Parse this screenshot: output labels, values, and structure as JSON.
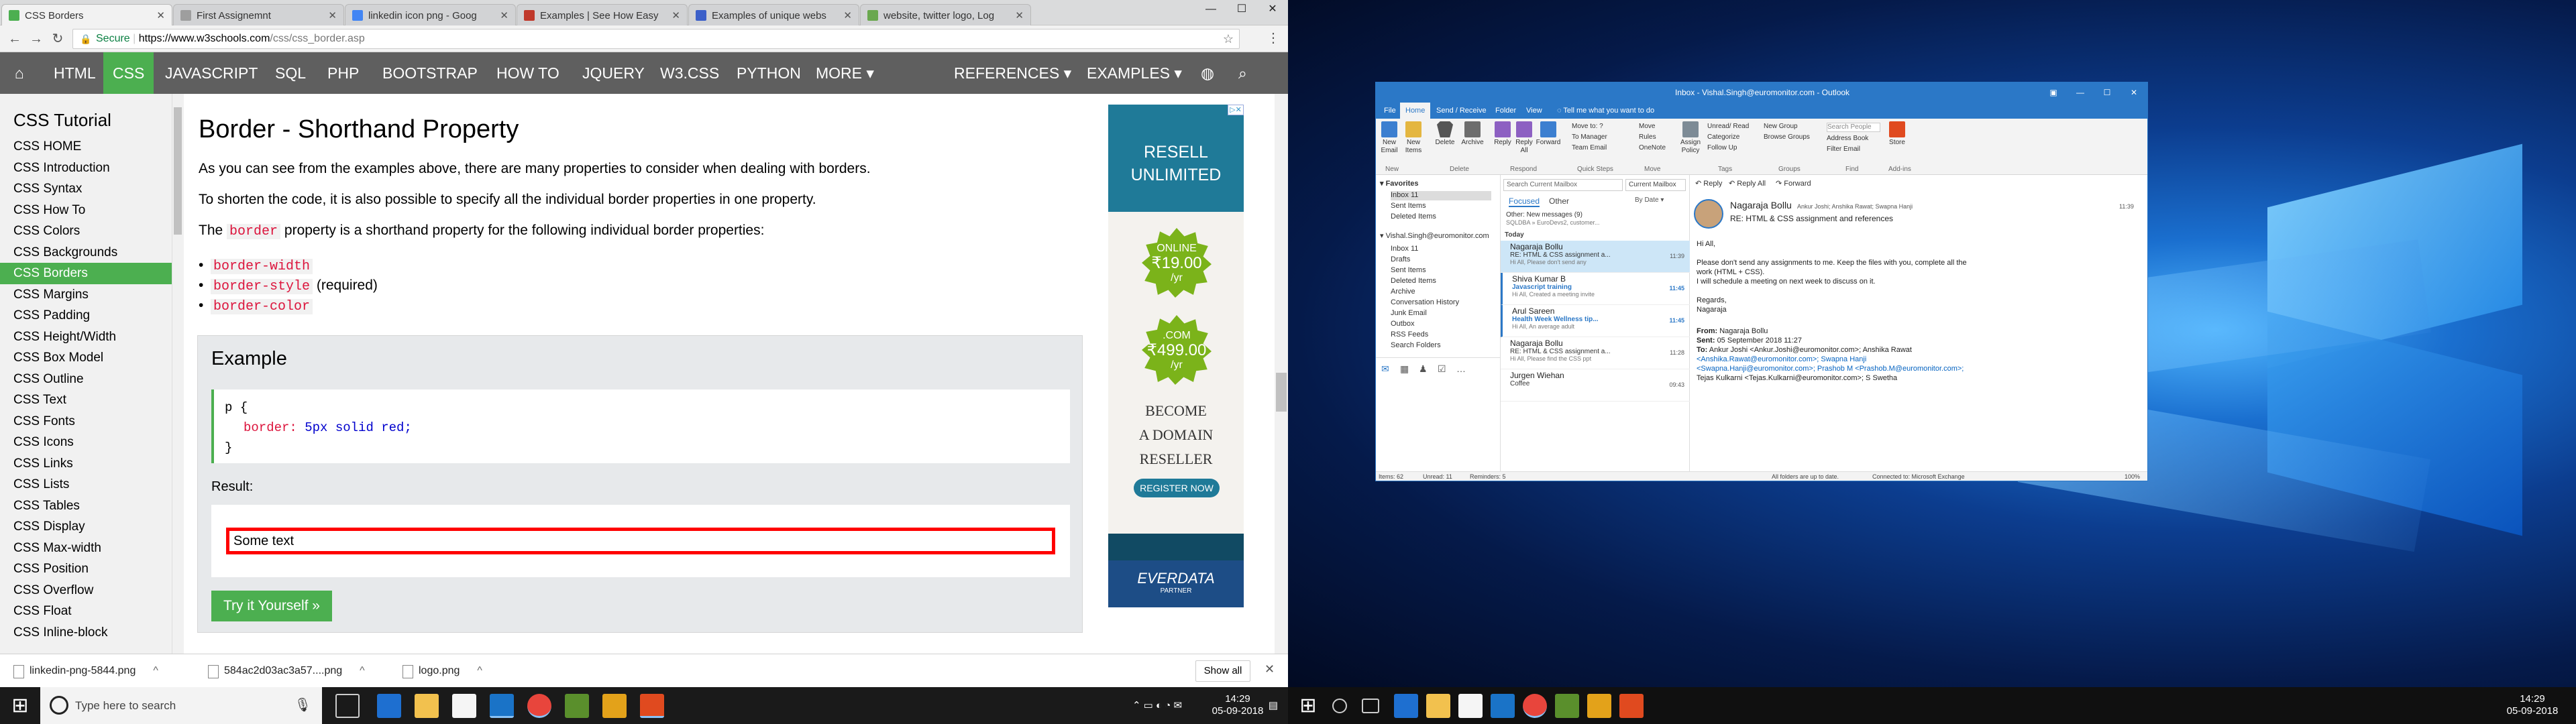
{
  "browser": {
    "tabs": [
      {
        "label": "CSS Borders",
        "color": "#4caf50"
      },
      {
        "label": "First Assignemnt",
        "color": "#9e9e9e"
      },
      {
        "label": "linkedin icon png - Goog",
        "color": "#9e9e9e"
      },
      {
        "label": "Examples | See How Easy",
        "color": "#c0392b"
      },
      {
        "label": "Examples of unique webs",
        "color": "#3b5fc9"
      },
      {
        "label": "website, twitter logo, Log",
        "color": "#6aa84f"
      }
    ],
    "address": {
      "secure": "Secure",
      "domain": "https://www.w3schools.com",
      "path": "/css/css_border.asp"
    }
  },
  "w3nav": {
    "items": [
      "HTML",
      "CSS",
      "JAVASCRIPT",
      "SQL",
      "PHP",
      "BOOTSTRAP",
      "HOW TO",
      "JQUERY",
      "W3.CSS",
      "PYTHON",
      "MORE ▾",
      "REFERENCES ▾",
      "EXAMPLES ▾"
    ],
    "active": "CSS"
  },
  "sidebar": {
    "title": "CSS Tutorial",
    "items": [
      "CSS HOME",
      "CSS Introduction",
      "CSS Syntax",
      "CSS How To",
      "CSS Colors",
      "CSS Backgrounds",
      "CSS Borders",
      "CSS Margins",
      "CSS Padding",
      "CSS Height/Width",
      "CSS Box Model",
      "CSS Outline",
      "CSS Text",
      "CSS Fonts",
      "CSS Icons",
      "CSS Links",
      "CSS Lists",
      "CSS Tables",
      "CSS Display",
      "CSS Max-width",
      "CSS Position",
      "CSS Overflow",
      "CSS Float",
      "CSS Inline-block"
    ],
    "active": "CSS Borders"
  },
  "main": {
    "heading": "Border - Shorthand Property",
    "p1": "As you can see from the examples above, there are many properties to consider when dealing with borders.",
    "p2": "To shorten the code, it is also possible to specify all the individual border properties in one property.",
    "p3a": "The",
    "p3code": "border",
    "p3b": "property is a shorthand property for the following individual border properties:",
    "bullets": [
      {
        "code": "border-width",
        "text": ""
      },
      {
        "code": "border-style",
        "text": "(required)"
      },
      {
        "code": "border-color",
        "text": ""
      }
    ],
    "example": {
      "title": "Example",
      "code_selector": "p {",
      "code_prop": "border:",
      "code_value": "5px solid red;",
      "code_close": "}",
      "result_label": "Result:",
      "result_text": "Some text",
      "try_button": "Try it Yourself »"
    }
  },
  "ad": {
    "headline1": "RESELL",
    "headline2": "UNLIMITED",
    "offer1_label": "ONLINE",
    "offer1_price": "₹19.00",
    "offer1_per": "/yr",
    "offer2_label": ".COM",
    "offer2_price": "₹499.00",
    "offer2_per": "/yr",
    "line1": "BECOME",
    "line2": "A DOMAIN",
    "line3": "RESELLER",
    "button": "REGISTER NOW",
    "brand": "EVERDATA",
    "brand_sub": "PARTNER"
  },
  "downloads": {
    "items": [
      "linkedin-png-5844.png",
      "584ac2d03ac3a57....png",
      "logo.png"
    ],
    "show_all": "Show all"
  },
  "taskbar": {
    "search_placeholder": "Type here to search",
    "time": "14:29",
    "date": "05-09-2018",
    "time2": "14:29",
    "date2": "05-09-2018"
  },
  "outlook": {
    "title": "Inbox - Vishal.Singh@euromonitor.com  -  Outlook",
    "tabs": [
      "File",
      "Home",
      "Send / Receive",
      "Folder",
      "View"
    ],
    "tellme": "Tell me what you want to do",
    "ribbon": {
      "new_email": "New Email",
      "new_items": "New Items",
      "delete": "Delete",
      "archive": "Archive",
      "reply": "Reply",
      "reply_all": "Reply All",
      "forward": "Forward",
      "quick_steps": [
        "Move to: ?",
        "To Manager",
        "Team Email"
      ],
      "move": "Move",
      "rules": "Rules",
      "onenote": "OneNote",
      "assign_policy": "Assign Policy",
      "unread_read": "Unread/ Read",
      "categorize": "Categorize",
      "follow_up": "Follow Up",
      "new_group": "New Group",
      "browse_groups": "Browse Groups",
      "search_people": "Search People",
      "address_book": "Address Book",
      "filter_email": "Filter Email",
      "store": "Store",
      "groups": [
        "New",
        "Delete",
        "Respond",
        "Quick Steps",
        "Move",
        "Tags",
        "Groups",
        "Find",
        "Add-ins"
      ]
    },
    "nav": {
      "favorites": "Favorites",
      "fav_items": [
        "Inbox  11",
        "Sent Items",
        "Deleted Items"
      ],
      "account": "Vishal.Singh@euromonitor.com",
      "folders": [
        "Inbox  11",
        "Drafts",
        "Sent Items",
        "Deleted Items",
        "Archive",
        "Conversation History",
        "Junk Email",
        "Outbox",
        "RSS Feeds",
        "Search Folders"
      ]
    },
    "list": {
      "search": "Search Current Mailbox",
      "mailbox": "Current Mailbox",
      "focused": "Focused",
      "other": "Other",
      "sort": "By Date ▾",
      "other_msgs": "Other: New messages (9)",
      "other_preview": "SQLDBA » EuroDevs2, customer...",
      "today": "Today",
      "messages": [
        {
          "sender": "Nagaraja Bollu",
          "subject": "RE: HTML & CSS assignment a...",
          "preview": "Hi All,  Please don't send any",
          "time": "11:39",
          "selected": true,
          "accent": false
        },
        {
          "sender": "Shiva Kumar B",
          "subject": "Javascript training",
          "preview": "Hi All,  Created a meeting invite",
          "time": "11:45",
          "selected": false,
          "accent": true
        },
        {
          "sender": "Arul Sareen",
          "subject": "Health Week   Wellness tip...",
          "preview": "Hi All,  An average adult",
          "time": "11:45",
          "selected": false,
          "accent": true
        },
        {
          "sender": "Nagaraja Bollu",
          "subject": "RE: HTML & CSS assignment a...",
          "preview": "Hi All,  Please find the CSS ppt",
          "time": "11:28",
          "selected": false,
          "accent": false
        },
        {
          "sender": "Jurgen Wiehan",
          "subject": "Coffee",
          "preview": "",
          "time": "09:43",
          "selected": false,
          "accent": false
        }
      ]
    },
    "reading": {
      "reply": "Reply",
      "reply_all": "Reply All",
      "forward": "Forward",
      "from_name": "Nagaraja Bollu",
      "recipients": "Ankur Joshi; Anshika Rawat; Swapna Hanji",
      "subject": "RE: HTML & CSS assignment and references",
      "time": "11:39",
      "greeting": "Hi All,",
      "body1": "Please don't send any assignments to me. Keep the files with you, complete all the",
      "body2": "work (HTML + CSS).",
      "body3": "I will schedule a meeting on next week to discuss on it.",
      "regards": "Regards,",
      "sign": "Nagaraja",
      "from_label": "From:",
      "from_val": "Nagaraja Bollu",
      "sent_label": "Sent:",
      "sent_val": "05 September 2018 11:27",
      "to_label": "To:",
      "to_line1": "Ankur Joshi <Ankur.Joshi@euromonitor.com>; Anshika Rawat",
      "to_line2": "<Anshika.Rawat@euromonitor.com>; Swapna Hanji",
      "to_line3": "<Swapna.Hanji@euromonitor.com>; Prashob M <Prashob.M@euromonitor.com>;",
      "to_line4": "Tejas Kulkarni <Tejas.Kulkarni@euromonitor.com>; S Swetha"
    },
    "status": {
      "items": "Items: 62",
      "unread": "Unread: 11",
      "reminders": "Reminders: 5",
      "folders": "All folders are up to date.",
      "connected": "Connected to: Microsoft Exchange",
      "zoom": "100%"
    }
  }
}
